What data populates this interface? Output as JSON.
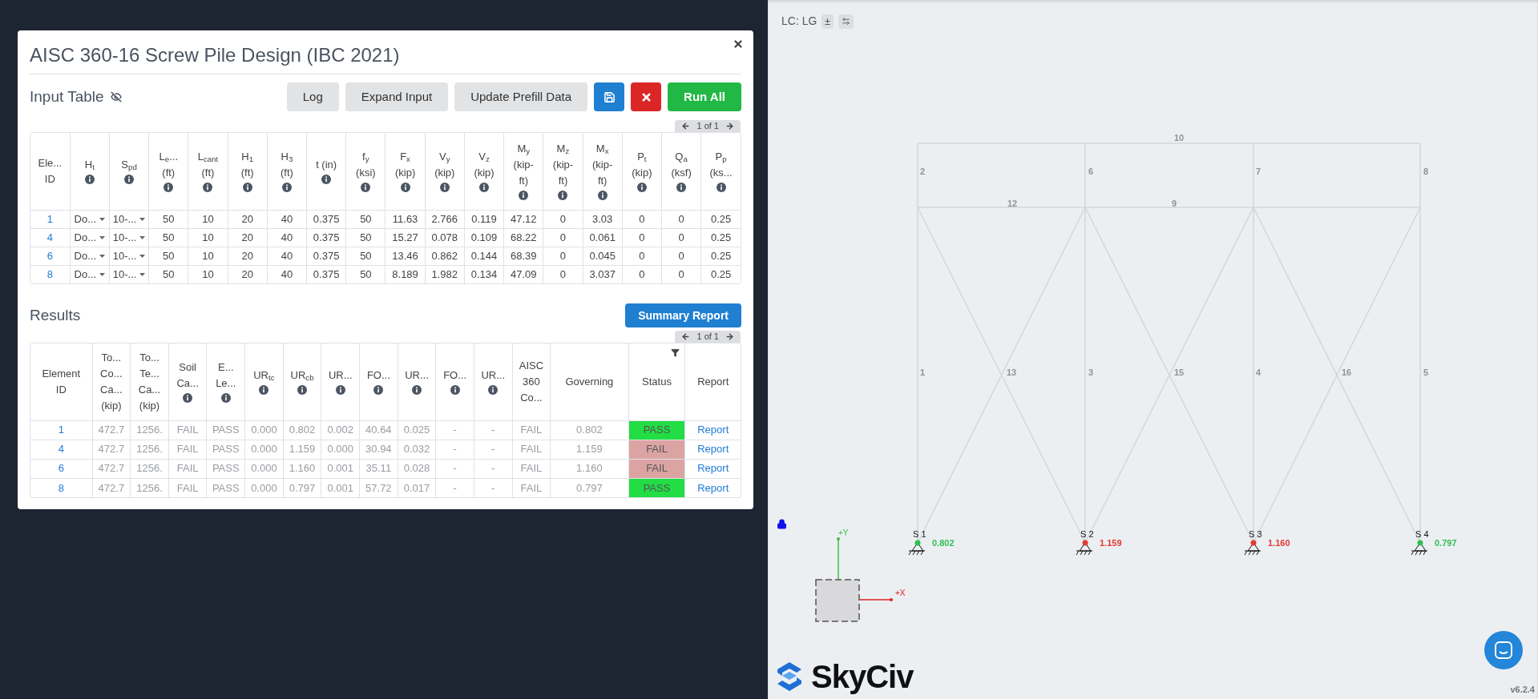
{
  "dialog": {
    "title": "AISC 360-16 Screw Pile Design (IBC 2021)",
    "input": {
      "title": "Input Table",
      "buttons": [
        {
          "kind": "text",
          "label": "Log"
        },
        {
          "kind": "text",
          "label": "Expand Input"
        },
        {
          "kind": "text",
          "label": "Update Prefill Data"
        },
        {
          "kind": "save"
        },
        {
          "kind": "delete"
        },
        {
          "kind": "run",
          "label": "Run All"
        }
      ],
      "pager": "1 of 1",
      "columns": [
        {
          "lines": [
            "Ele...",
            "ID"
          ],
          "info": false,
          "kind": "link"
        },
        {
          "lines": [
            "H$_{t}$"
          ],
          "info": true,
          "kind": "select"
        },
        {
          "lines": [
            "S$_{pd}$"
          ],
          "info": true,
          "kind": "select"
        },
        {
          "lines": [
            "L$_{e}$...",
            "(ft)"
          ],
          "info": true,
          "kind": "value"
        },
        {
          "lines": [
            "L$_{cant}$",
            "(ft)"
          ],
          "info": true,
          "kind": "value"
        },
        {
          "lines": [
            "H$_{1}$",
            "(ft)"
          ],
          "info": true,
          "kind": "value"
        },
        {
          "lines": [
            "H$_{3}$",
            "(ft)"
          ],
          "info": true,
          "kind": "value"
        },
        {
          "lines": [
            "t (in)"
          ],
          "info": true,
          "kind": "value"
        },
        {
          "lines": [
            "f$_{y}$",
            "(ksi)"
          ],
          "info": true,
          "kind": "value"
        },
        {
          "lines": [
            "F$_{x}$",
            "(kip)"
          ],
          "info": true,
          "kind": "value"
        },
        {
          "lines": [
            "V$_{y}$",
            "(kip)"
          ],
          "info": true,
          "kind": "value"
        },
        {
          "lines": [
            "V$_{z}$",
            "(kip)"
          ],
          "info": true,
          "kind": "value"
        },
        {
          "lines": [
            "M$_{y}$",
            "(kip-",
            "ft)"
          ],
          "info": true,
          "kind": "value"
        },
        {
          "lines": [
            "M$_{z}$",
            "(kip-",
            "ft)"
          ],
          "info": true,
          "kind": "value"
        },
        {
          "lines": [
            "M$_{x}$",
            "(kip-",
            "ft)"
          ],
          "info": true,
          "kind": "value"
        },
        {
          "lines": [
            "P$_{t}$",
            "(kip)"
          ],
          "info": true,
          "kind": "value"
        },
        {
          "lines": [
            "Q$_{a}$",
            "(ksf)"
          ],
          "info": true,
          "kind": "value"
        },
        {
          "lines": [
            "P$_{p}$",
            "(ks..."
          ],
          "info": true,
          "kind": "value"
        }
      ],
      "rows": [
        {
          "cells": [
            "1",
            "Do...",
            "10-...",
            "50",
            "10",
            "20",
            "40",
            "0.375",
            "50",
            "11.63",
            "2.766",
            "0.119",
            "47.12",
            "0",
            "3.03",
            "0",
            "0",
            "0.25"
          ]
        },
        {
          "cells": [
            "4",
            "Do...",
            "10-...",
            "50",
            "10",
            "20",
            "40",
            "0.375",
            "50",
            "15.27",
            "0.078",
            "0.109",
            "68.22",
            "0",
            "0.061",
            "0",
            "0",
            "0.25"
          ]
        },
        {
          "cells": [
            "6",
            "Do...",
            "10-...",
            "50",
            "10",
            "20",
            "40",
            "0.375",
            "50",
            "13.46",
            "0.862",
            "0.144",
            "68.39",
            "0",
            "0.045",
            "0",
            "0",
            "0.25"
          ]
        },
        {
          "cells": [
            "8",
            "Do...",
            "10-...",
            "50",
            "10",
            "20",
            "40",
            "0.375",
            "50",
            "8.189",
            "1.982",
            "0.134",
            "47.09",
            "0",
            "3.037",
            "0",
            "0",
            "0.25"
          ]
        }
      ]
    },
    "results": {
      "title": "Results",
      "summary_button": "Summary Report",
      "pager": "1 of 1",
      "columns": [
        {
          "lines": [
            "Element",
            "ID"
          ],
          "info": false,
          "filter": false,
          "kind": "link"
        },
        {
          "lines": [
            "To...",
            "Co...",
            "Ca...",
            "(kip)"
          ],
          "info": false,
          "filter": false,
          "kind": "value"
        },
        {
          "lines": [
            "To...",
            "Te...",
            "Ca...",
            "(kip)"
          ],
          "info": false,
          "filter": false,
          "kind": "value"
        },
        {
          "lines": [
            "Soil",
            "Ca..."
          ],
          "info": true,
          "filter": false,
          "kind": "value"
        },
        {
          "lines": [
            "E...",
            "Le..."
          ],
          "info": true,
          "filter": false,
          "kind": "value"
        },
        {
          "lines": [
            "UR$_{tc}$"
          ],
          "info": true,
          "filter": false,
          "kind": "value"
        },
        {
          "lines": [
            "UR$_{cb}$"
          ],
          "info": true,
          "filter": false,
          "kind": "value"
        },
        {
          "lines": [
            "UR..."
          ],
          "info": true,
          "filter": false,
          "kind": "value"
        },
        {
          "lines": [
            "FO..."
          ],
          "info": true,
          "filter": false,
          "kind": "value"
        },
        {
          "lines": [
            "UR..."
          ],
          "info": true,
          "filter": false,
          "kind": "value"
        },
        {
          "lines": [
            "FO..."
          ],
          "info": true,
          "filter": false,
          "kind": "value"
        },
        {
          "lines": [
            "UR..."
          ],
          "info": true,
          "filter": false,
          "kind": "value"
        },
        {
          "lines": [
            "AISC",
            "360",
            "Co..."
          ],
          "info": false,
          "filter": false,
          "kind": "value"
        },
        {
          "lines": [
            "Governing"
          ],
          "info": false,
          "filter": false,
          "kind": "value"
        },
        {
          "lines": [
            "Status"
          ],
          "info": false,
          "filter": true,
          "kind": "status"
        },
        {
          "lines": [
            "Report"
          ],
          "info": false,
          "filter": false,
          "kind": "report"
        }
      ],
      "rows": [
        {
          "pass": true,
          "cells": [
            "1",
            "472.7",
            "1256.",
            "FAIL",
            "PASS",
            "0.000",
            "0.802",
            "0.002",
            "40.64",
            "0.025",
            "-",
            "-",
            "FAIL",
            "0.802",
            "PASS",
            "Report"
          ]
        },
        {
          "pass": false,
          "cells": [
            "4",
            "472.7",
            "1256.",
            "FAIL",
            "PASS",
            "0.000",
            "1.159",
            "0.000",
            "30.94",
            "0.032",
            "-",
            "-",
            "FAIL",
            "1.159",
            "FAIL",
            "Report"
          ]
        },
        {
          "pass": false,
          "cells": [
            "6",
            "472.7",
            "1256.",
            "FAIL",
            "PASS",
            "0.000",
            "1.160",
            "0.001",
            "35.11",
            "0.028",
            "-",
            "-",
            "FAIL",
            "1.160",
            "FAIL",
            "Report"
          ]
        },
        {
          "pass": true,
          "cells": [
            "8",
            "472.7",
            "1256.",
            "FAIL",
            "PASS",
            "0.000",
            "0.797",
            "0.001",
            "57.72",
            "0.017",
            "-",
            "-",
            "FAIL",
            "0.797",
            "PASS",
            "Report"
          ]
        }
      ]
    }
  },
  "canvas": {
    "load_case": "LC: LG",
    "sign_toggle": "±",
    "member_labels": [
      "10",
      "2",
      "6",
      "7",
      "8",
      "12",
      "9",
      "1",
      "13",
      "3",
      "15",
      "4",
      "16",
      "5"
    ],
    "supports": [
      {
        "label": "S 1",
        "value": "0.802",
        "color": "#2fbf55"
      },
      {
        "label": "S 2",
        "value": "1.159",
        "color": "#e53935"
      },
      {
        "label": "S 3",
        "value": "1.160",
        "color": "#e53935"
      },
      {
        "label": "S 4",
        "value": "0.797",
        "color": "#2fbf55"
      }
    ],
    "axes": {
      "y": "+Y",
      "x": "+X"
    },
    "logo": "SkyCiv",
    "version": "v6.2.4"
  }
}
